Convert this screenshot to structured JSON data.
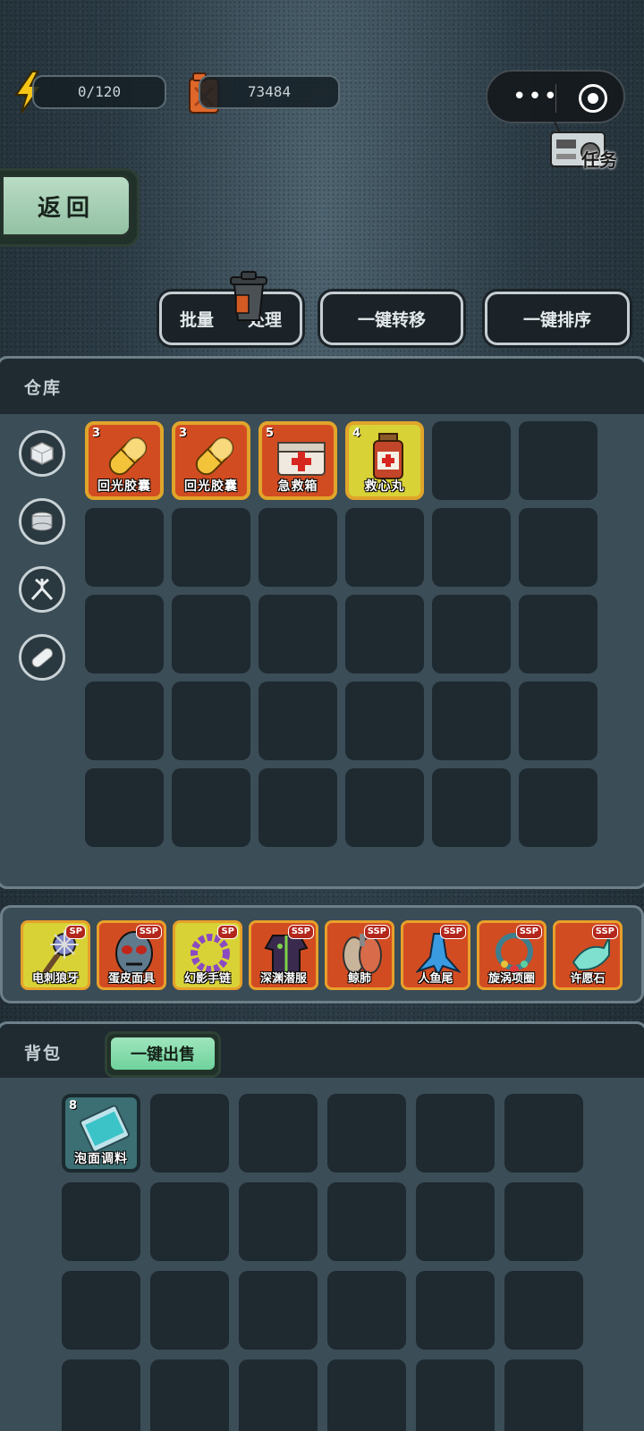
{
  "resources": {
    "energy": "0/120",
    "fuel": "73484"
  },
  "task_label": "任务",
  "back_label": "返回",
  "actions": {
    "batch_1": "批量",
    "batch_2": "处理",
    "transfer": "一键转移",
    "sort": "一键排序"
  },
  "warehouse": {
    "title": "仓库",
    "categories": [
      "box-icon",
      "can-icon",
      "trap-icon",
      "pill-icon"
    ],
    "items": [
      {
        "count": "3",
        "name": "回光胶囊",
        "icon": "capsule-icon"
      },
      {
        "count": "3",
        "name": "回光胶囊",
        "icon": "capsule-icon"
      },
      {
        "count": "5",
        "name": "急救箱",
        "icon": "first-aid-kit-icon"
      },
      {
        "count": "4",
        "name": "救心丸",
        "icon": "medicine-bottle-icon"
      }
    ]
  },
  "equipment": [
    {
      "name": "电刺狼牙",
      "tag": "SP"
    },
    {
      "name": "蛋皮面具",
      "tag": "SSP"
    },
    {
      "name": "幻影手链",
      "tag": "SP"
    },
    {
      "name": "深渊潜服",
      "tag": "SSP"
    },
    {
      "name": "鲸肺",
      "tag": "SSP"
    },
    {
      "name": "人鱼尾",
      "tag": "SSP"
    },
    {
      "name": "旋涡项圈",
      "tag": "SSP"
    },
    {
      "name": "许愿石",
      "tag": "SSP"
    }
  ],
  "backpack": {
    "title": "背包",
    "sell": "一键出售",
    "items": [
      {
        "count": "8",
        "name": "泡面调料",
        "icon": "seasoning-packet-icon"
      }
    ]
  }
}
